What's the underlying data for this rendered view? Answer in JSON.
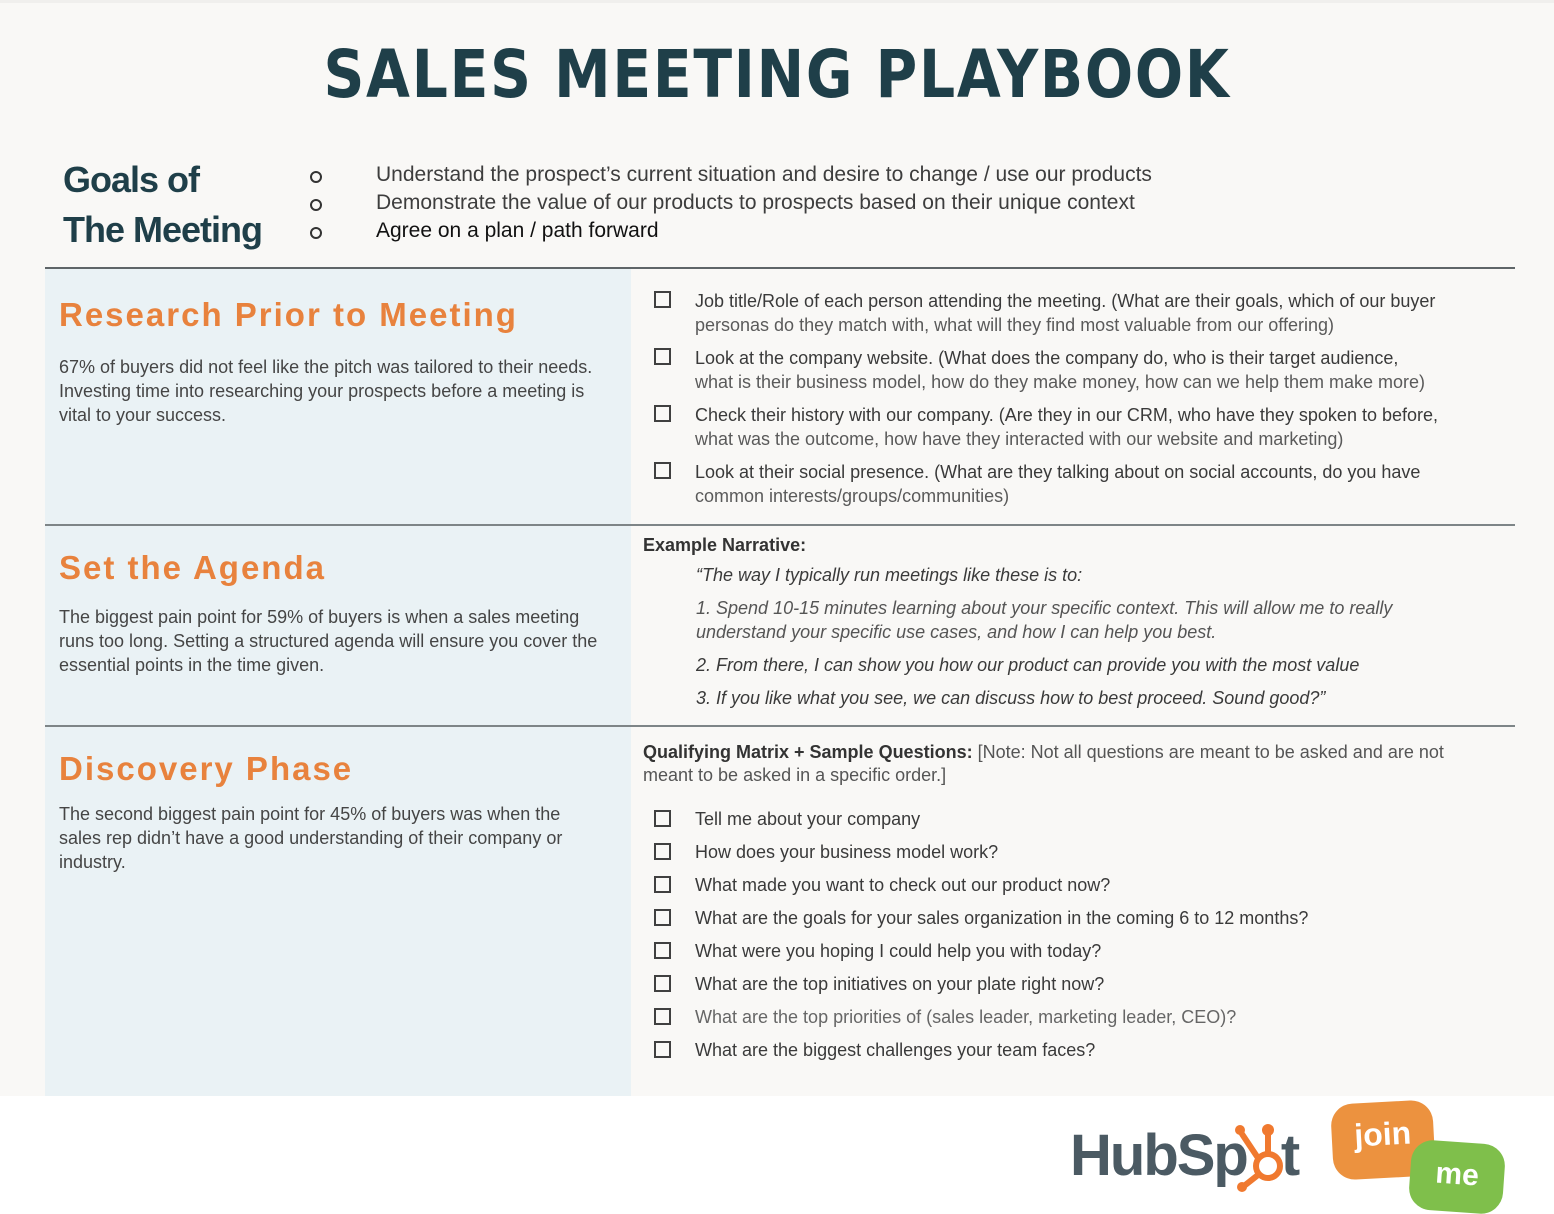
{
  "title": "SALES MEETING PLAYBOOK",
  "goals": {
    "heading_line1": "Goals of",
    "heading_line2": "The Meeting",
    "items": [
      "Understand the prospect’s current situation and desire to change / use our products",
      "Demonstrate the value of our products to prospects based on their unique context",
      "Agree on a plan / path forward"
    ]
  },
  "research": {
    "title": "Research Prior to Meeting",
    "description": "67% of buyers did not feel like the pitch was tailored to their needs. Investing time into researching your prospects before a meeting is vital to your success.",
    "checklist": [
      {
        "main": "Job title/Role of each person attending the meeting. (What are their goals, which of our buyer",
        "sub": "personas do they match with, what will they find most valuable from our offering)"
      },
      {
        "main": "Look at the company website. (What does the company do, who is their target audience,",
        "sub": "what is their business model, how do they make money, how can we help them make more)"
      },
      {
        "main": "Check their history with our company. (Are they in our CRM, who have they spoken to before,",
        "sub": "what was the outcome, how have they interacted with our website and marketing)"
      },
      {
        "main": "Look at their social presence. (What are they talking about on social accounts, do you have",
        "sub": "common interests/groups/communities)"
      }
    ]
  },
  "agenda": {
    "title": "Set the Agenda",
    "description": "The biggest pain point for 59% of buyers is when a sales meeting runs too long. Setting a structured agenda will ensure you cover the essential points in the time given.",
    "narrative_label": "Example Narrative:",
    "narrative": [
      "“The way I typically run meetings like these is to:",
      "1. Spend 10-15 minutes learning about your specific context.  This will allow me to really understand your specific use cases, and how I can help you best.",
      "2. From there, I can show you how our product can provide you with the most value",
      "3. If you like what you see, we can discuss how to best proceed. Sound good?”"
    ]
  },
  "discovery": {
    "title": "Discovery Phase",
    "description": "The second biggest pain point for 45% of buyers was when the sales rep didn’t have a good understanding of their company or industry.",
    "matrix_label": "Qualifying Matrix + Sample Questions:",
    "matrix_note": "[Note:  Not all questions are meant to be asked and are not meant to be asked in a specific order.]",
    "questions": [
      "Tell me about your company",
      "How does your business model work?",
      "What made you want to check out our product now?",
      "What are the goals for your sales organization in the coming 6 to 12 months?",
      "What were you hoping I could help you with today?",
      "What are the top initiatives on your plate right now?",
      "What are the top priorities of (sales leader, marketing leader, CEO)?",
      "What are the biggest challenges your team faces?"
    ]
  },
  "footer": {
    "hubspot_logo_text": "HubSpot",
    "hubspot_logo_prefix": "HubSp",
    "hubspot_logo_suffix": "t",
    "joinme_top": "join",
    "joinme_bottom": "me"
  },
  "colors": {
    "title": "#1f3f49",
    "accent_orange": "#e8823d",
    "left_panel_bg": "#eaf2f5",
    "page_bg": "#f9f8f6",
    "hubspot_gray": "#4b5a63",
    "hubspot_orange": "#f0792f",
    "joinme_orange": "#ec923f",
    "joinme_green": "#7fbf4b"
  }
}
